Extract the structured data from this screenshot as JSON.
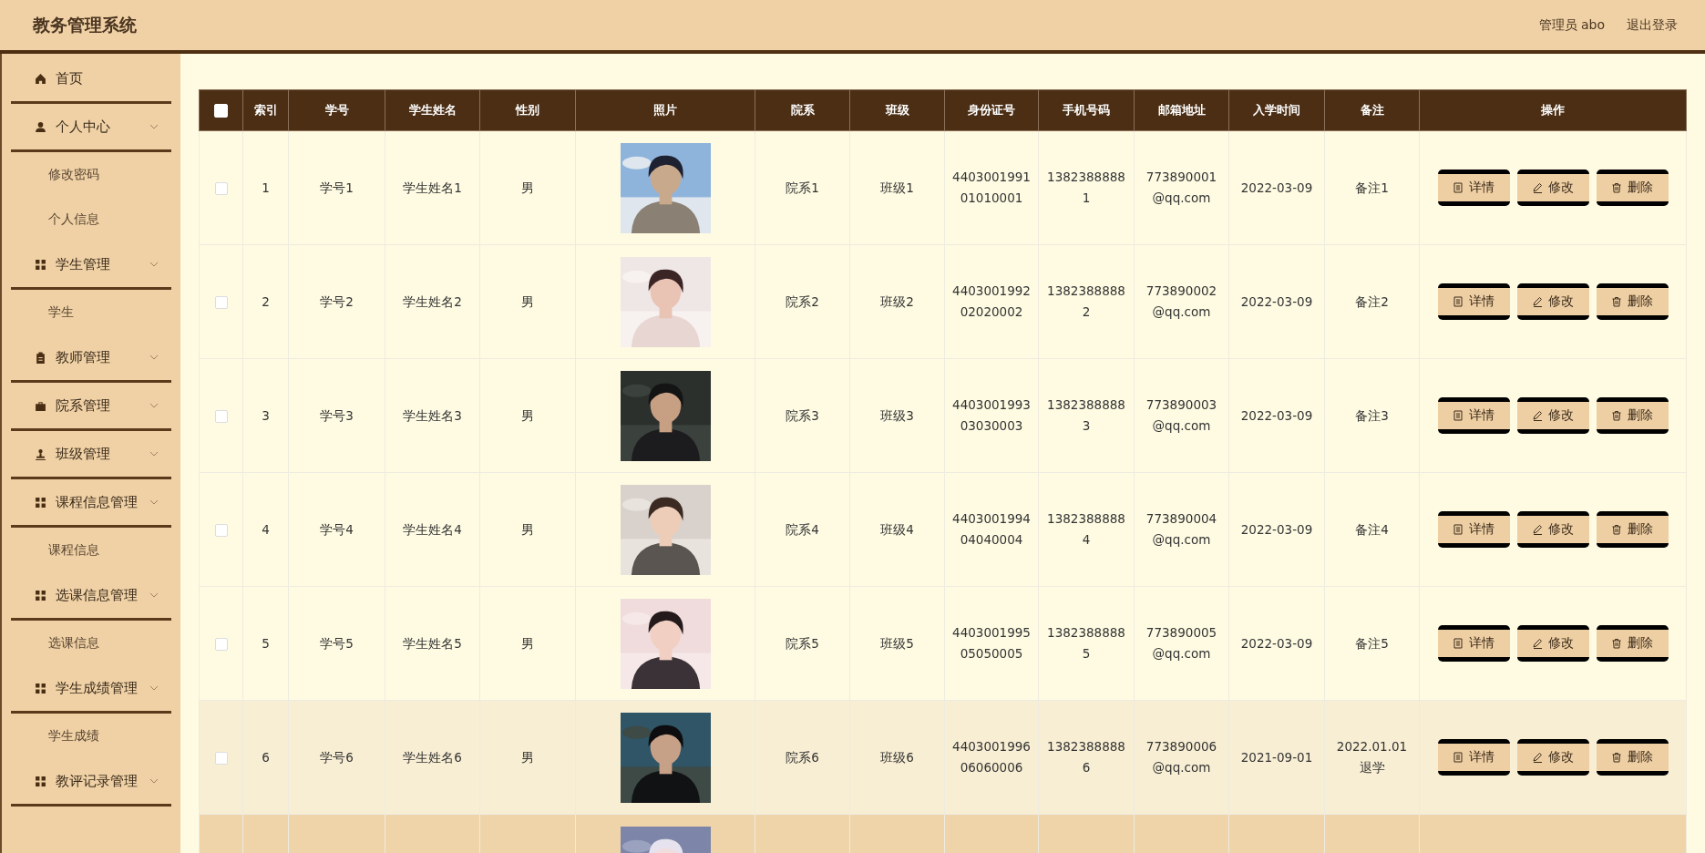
{
  "header": {
    "title": "教务管理系统",
    "user": "管理员 abo",
    "logout": "退出登录"
  },
  "sidebar": {
    "items": [
      {
        "kind": "menu",
        "label": "首页",
        "expandable": false
      },
      {
        "kind": "menu",
        "label": "个人中心",
        "expandable": true
      },
      {
        "kind": "sub",
        "label": "修改密码"
      },
      {
        "kind": "sub",
        "label": "个人信息"
      },
      {
        "kind": "menu",
        "label": "学生管理",
        "expandable": true
      },
      {
        "kind": "sub",
        "label": "学生"
      },
      {
        "kind": "menu",
        "label": "教师管理",
        "expandable": true
      },
      {
        "kind": "menu",
        "label": "院系管理",
        "expandable": true
      },
      {
        "kind": "menu",
        "label": "班级管理",
        "expandable": true
      },
      {
        "kind": "menu",
        "label": "课程信息管理",
        "expandable": true
      },
      {
        "kind": "sub",
        "label": "课程信息"
      },
      {
        "kind": "menu",
        "label": "选课信息管理",
        "expandable": true
      },
      {
        "kind": "sub",
        "label": "选课信息"
      },
      {
        "kind": "menu",
        "label": "学生成绩管理",
        "expandable": true
      },
      {
        "kind": "sub",
        "label": "学生成绩"
      },
      {
        "kind": "menu",
        "label": "教评记录管理",
        "expandable": true
      }
    ]
  },
  "table": {
    "select_all_checked": false,
    "columns": [
      "索引",
      "学号",
      "学生姓名",
      "性别",
      "照片",
      "院系",
      "班级",
      "身份证号",
      "手机号码",
      "邮箱地址",
      "入学时间",
      "备注",
      "操作"
    ],
    "rows": [
      {
        "hovered": false,
        "selected": false,
        "checked": false,
        "cells": [
          "1",
          "学号1",
          "学生姓名1",
          "男",
          null,
          "院系1",
          "班级1",
          "440300199101010001",
          "13823888881",
          "773890001@qq.com",
          "2022-03-09",
          "备注1"
        ],
        "actions": [
          {
            "kind": "detail",
            "label": "详情"
          },
          {
            "kind": "edit",
            "label": "修改"
          },
          {
            "kind": "delete",
            "label": "删除"
          }
        ]
      },
      {
        "hovered": false,
        "selected": false,
        "checked": false,
        "cells": [
          "2",
          "学号2",
          "学生姓名2",
          "男",
          null,
          "院系2",
          "班级2",
          "440300199202020002",
          "13823888882",
          "773890002@qq.com",
          "2022-03-09",
          "备注2"
        ],
        "actions": [
          {
            "kind": "detail",
            "label": "详情"
          },
          {
            "kind": "edit",
            "label": "修改"
          },
          {
            "kind": "delete",
            "label": "删除"
          }
        ]
      },
      {
        "hovered": false,
        "selected": false,
        "checked": false,
        "cells": [
          "3",
          "学号3",
          "学生姓名3",
          "男",
          null,
          "院系3",
          "班级3",
          "440300199303030003",
          "13823888883",
          "773890003@qq.com",
          "2022-03-09",
          "备注3"
        ],
        "actions": [
          {
            "kind": "detail",
            "label": "详情"
          },
          {
            "kind": "edit",
            "label": "修改"
          },
          {
            "kind": "delete",
            "label": "删除"
          }
        ]
      },
      {
        "hovered": false,
        "selected": false,
        "checked": false,
        "cells": [
          "4",
          "学号4",
          "学生姓名4",
          "男",
          null,
          "院系4",
          "班级4",
          "440300199404040004",
          "13823888884",
          "773890004@qq.com",
          "2022-03-09",
          "备注4"
        ],
        "actions": [
          {
            "kind": "detail",
            "label": "详情"
          },
          {
            "kind": "edit",
            "label": "修改"
          },
          {
            "kind": "delete",
            "label": "删除"
          }
        ]
      },
      {
        "hovered": false,
        "selected": false,
        "checked": false,
        "cells": [
          "5",
          "学号5",
          "学生姓名5",
          "男",
          null,
          "院系5",
          "班级5",
          "440300199505050005",
          "13823888885",
          "773890005@qq.com",
          "2022-03-09",
          "备注5"
        ],
        "actions": [
          {
            "kind": "detail",
            "label": "详情"
          },
          {
            "kind": "edit",
            "label": "修改"
          },
          {
            "kind": "delete",
            "label": "删除"
          }
        ]
      },
      {
        "hovered": true,
        "selected": false,
        "checked": false,
        "cells": [
          "6",
          "学号6",
          "学生姓名6",
          "男",
          null,
          "院系6",
          "班级6",
          "440300199606060006",
          "13823888886",
          "773890006@qq.com",
          "2021-09-01",
          "2022.01.01 退学"
        ],
        "actions": [
          {
            "kind": "detail",
            "label": "详情"
          },
          {
            "kind": "edit",
            "label": "修改"
          },
          {
            "kind": "delete",
            "label": "删除"
          }
        ]
      },
      {
        "hovered": false,
        "selected": true,
        "cells": [
          null,
          null,
          null,
          null,
          null,
          null,
          null,
          null,
          null,
          null,
          null,
          null
        ]
      }
    ]
  }
}
